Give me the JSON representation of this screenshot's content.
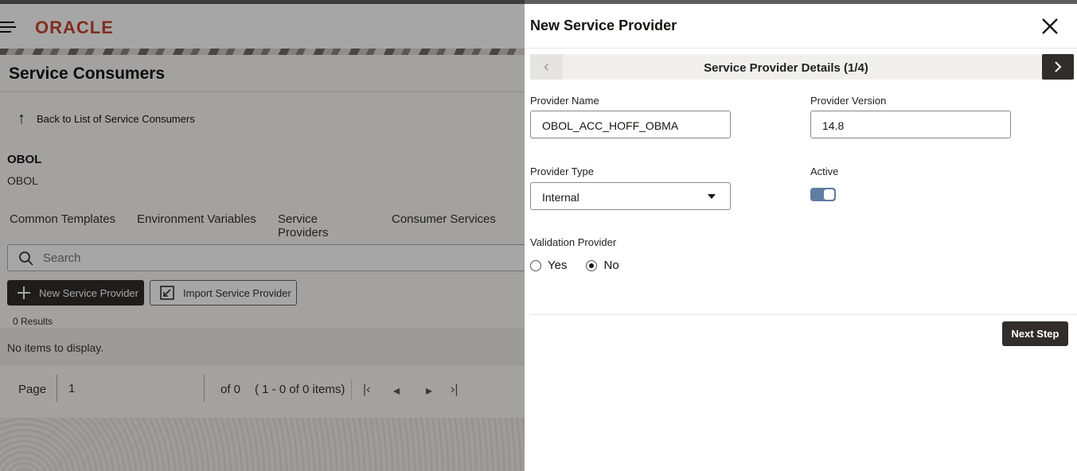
{
  "app": {
    "brand": "ORACLE"
  },
  "page": {
    "title": "Service Consumers",
    "back_label": "Back to List of Service Consumers",
    "consumer_title": "OBOL",
    "consumer_subtitle": "OBOL",
    "tabs": [
      {
        "label": "Common Templates"
      },
      {
        "label": "Environment Variables"
      },
      {
        "label": "Service Providers",
        "active": true
      },
      {
        "label": "Consumer Services"
      }
    ],
    "search": {
      "placeholder": "Search",
      "value": ""
    },
    "buttons": {
      "new_provider": "New Service Provider",
      "import_provider": "Import Service Provider"
    },
    "results_count": "0 Results",
    "empty_message": "No items to display.",
    "pager": {
      "page_label": "Page",
      "page_value": "1",
      "of_label": "of 0",
      "range_label": "( 1 - 0 of 0 items)"
    }
  },
  "drawer": {
    "title": "New Service Provider",
    "step_title": "Service Provider Details  (1/4)",
    "fields": {
      "provider_name": {
        "label": "Provider Name",
        "value": "OBOL_ACC_HOFF_OBMA"
      },
      "provider_version": {
        "label": "Provider Version",
        "value": "14.8"
      },
      "provider_type": {
        "label": "Provider Type",
        "value": "Internal"
      },
      "active": {
        "label": "Active",
        "value": true
      },
      "validation_provider": {
        "label": "Validation Provider",
        "options": [
          "Yes",
          "No"
        ],
        "selected": "No"
      }
    },
    "next_step_label": "Next Step"
  },
  "colors": {
    "brand": "#c74634",
    "primary_button": "#312d2a",
    "toggle_on": "#5f7d9e"
  }
}
